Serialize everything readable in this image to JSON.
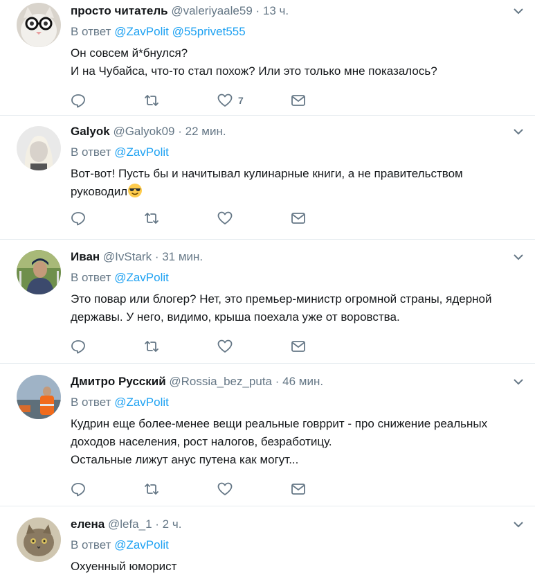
{
  "tweets": [
    {
      "name": "просто читатель",
      "handle": "@valeriyaale59",
      "separator": "·",
      "time": "13 ч.",
      "reply_prefix": "В ответ",
      "mentions": [
        "@ZavPolit",
        "@55privet555"
      ],
      "lines": [
        "Он совсем й*бнулся?",
        "И на Чубайса, что-то стал похож? Или это только мне показалось?"
      ],
      "likes": "7"
    },
    {
      "name": "Galyok",
      "handle": "@Galyok09",
      "separator": "·",
      "time": "22 мин.",
      "reply_prefix": "В ответ",
      "mentions": [
        "@ZavPolit"
      ],
      "lines": [
        "Вот-вот! Пусть бы и начитывал кулинарные книги, а не правительством",
        "руководил"
      ],
      "emoji": "smiling-face-with-sunglasses-emoji",
      "likes": ""
    },
    {
      "name": "Иван",
      "handle": "@IvStark",
      "separator": "·",
      "time": "31 мин.",
      "reply_prefix": "В ответ",
      "mentions": [
        "@ZavPolit"
      ],
      "lines": [
        "Это повар или блогер? Нет, это премьер-министр огромной страны, ядерной",
        "державы. У него, видимо, крыша поехала уже от воровства."
      ],
      "likes": ""
    },
    {
      "name": "Дмитро Русский",
      "handle": "@Rossia_bez_puta",
      "separator": "·",
      "time": "46 мин.",
      "reply_prefix": "В ответ",
      "mentions": [
        "@ZavPolit"
      ],
      "lines": [
        "Кудрин еще более-менее вещи реальные говррит - про снижение реальных",
        "доходов населения, рост налогов, безработицу.",
        "Остальные лижут анус путена как могут..."
      ],
      "likes": ""
    },
    {
      "name": "елена",
      "handle": "@lefa_1",
      "separator": "·",
      "time": "2 ч.",
      "reply_prefix": "В ответ",
      "mentions": [
        "@ZavPolit"
      ],
      "lines": [
        "Охуенный юморист"
      ],
      "likes": ""
    }
  ],
  "icons": {
    "reply": "reply-icon",
    "retweet": "retweet-icon",
    "like": "heart-icon",
    "dm": "envelope-icon",
    "menu": "chevron-down-icon"
  },
  "colors": {
    "link": "#1da1f2",
    "secondary": "#657786",
    "text": "#14171a",
    "divider": "#e6ecf0"
  }
}
